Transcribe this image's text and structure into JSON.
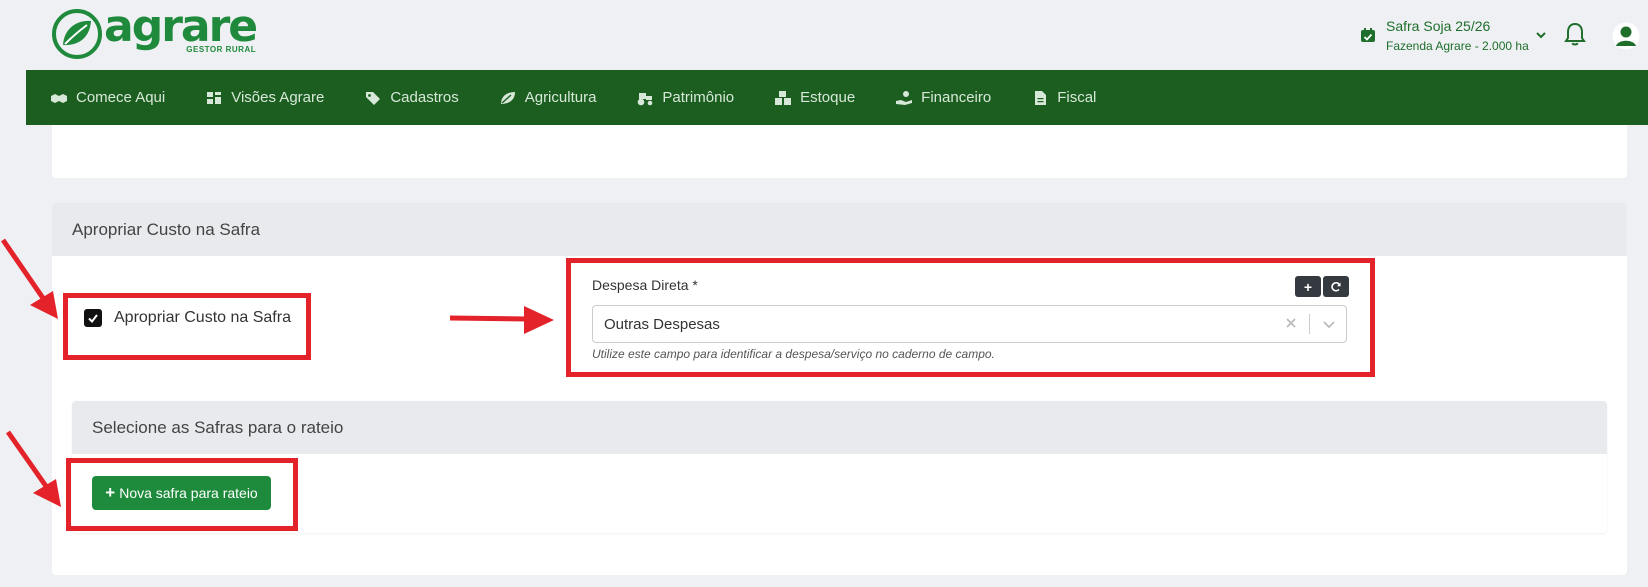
{
  "logo": {
    "word": "agrare",
    "sub": "GESTOR RURAL"
  },
  "safra": {
    "title": "Safra Soja 25/26",
    "subtitle": "Fazenda Agrare - 2.000 ha"
  },
  "nav": {
    "items": [
      {
        "label": "Comece Aqui",
        "icon": "handshake-icon"
      },
      {
        "label": "Visões Agrare",
        "icon": "dashboard-icon"
      },
      {
        "label": "Cadastros",
        "icon": "tags-icon"
      },
      {
        "label": "Agricultura",
        "icon": "leaf-icon"
      },
      {
        "label": "Patrimônio",
        "icon": "tractor-icon"
      },
      {
        "label": "Estoque",
        "icon": "boxes-icon"
      },
      {
        "label": "Financeiro",
        "icon": "hand-coin-icon"
      },
      {
        "label": "Fiscal",
        "icon": "file-invoice-icon"
      }
    ]
  },
  "section": {
    "title": "Apropriar Custo na Safra",
    "checkbox_label": "Apropriar Custo na Safra",
    "checked": true
  },
  "despesa": {
    "label": "Despesa Direta *",
    "add_label": "+",
    "value": "Outras Despesas",
    "help": "Utilize este campo para identificar a despesa/serviço no caderno de campo."
  },
  "rateio": {
    "title": "Selecione as Safras para o rateio",
    "button_label": "Nova safra para rateio"
  },
  "colors": {
    "brand_green": "#1f8a3c",
    "nav_green": "#1b5e20",
    "highlight_red": "#e3222a"
  }
}
